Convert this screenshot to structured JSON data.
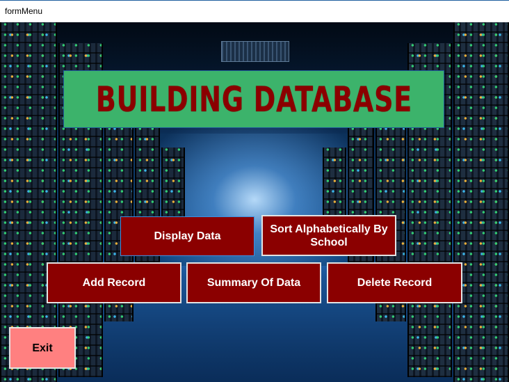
{
  "window": {
    "title": "formMenu"
  },
  "banner": {
    "text": "BUILDING DATABASE"
  },
  "buttons": {
    "display": "Display Data",
    "sort": "Sort Alphabetically By School",
    "add": "Add Record",
    "summary": "Summary Of Data",
    "delete": "Delete Record",
    "exit": "Exit"
  },
  "colors": {
    "banner_bg": "#3cb36b",
    "banner_text": "#8b0000",
    "button_bg": "#8b0000",
    "exit_bg": "#ff8080"
  }
}
